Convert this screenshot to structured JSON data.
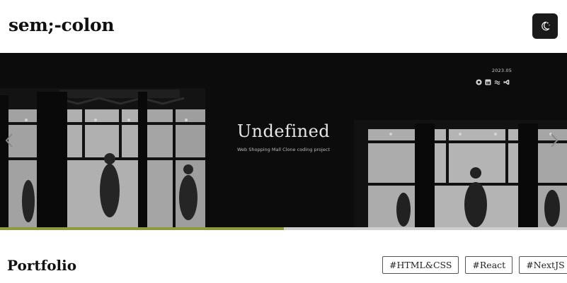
{
  "header": {
    "logo": "sem;-colon",
    "theme_toggle_icon": "moon-stars-icon"
  },
  "carousel": {
    "slide": {
      "date": "2023.05",
      "title": "Undefined",
      "subtitle": "Web Shopping Mall Clone coding project",
      "stack_icons": [
        "circle-logo-icon",
        "square-logo-icon",
        "wave-logo-icon",
        "vscode-logo-icon"
      ]
    },
    "prev_icon": "chevron-left-icon",
    "next_icon": "chevron-right-icon",
    "progress": 0.5
  },
  "portfolio": {
    "title": "Portfolio",
    "tags": [
      "#HTML&CSS",
      "#React",
      "#NextJS"
    ]
  },
  "colors": {
    "accent": "#8e9a3c",
    "toggle_bg": "#1a1a1a",
    "hero_bg": "#0d0d0d"
  }
}
